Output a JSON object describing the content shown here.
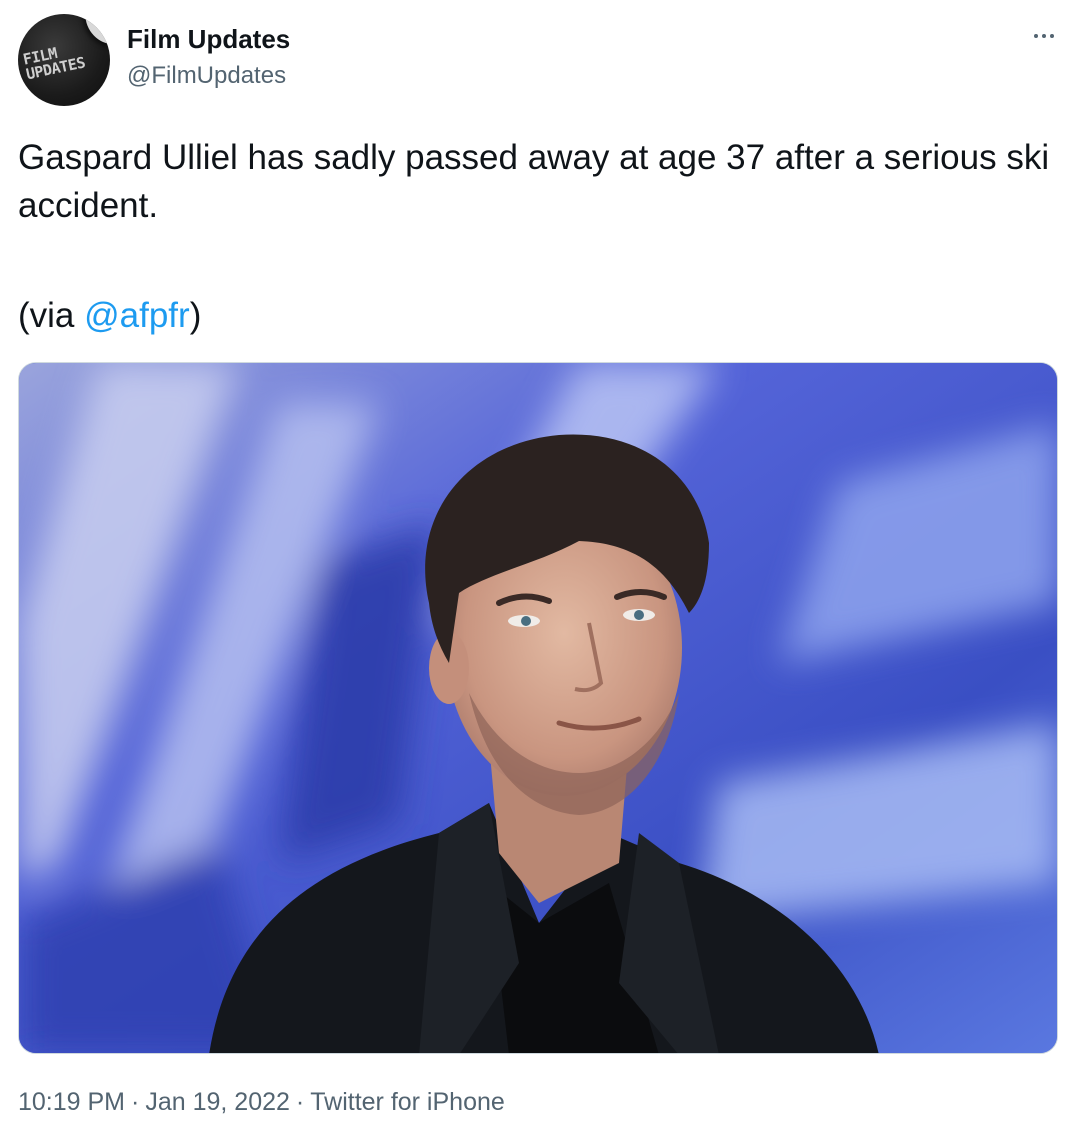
{
  "author": {
    "name": "Film Updates",
    "handle": "@FilmUpdates",
    "avatar_logo_text": "FILM UPDATES"
  },
  "tweet": {
    "text": "Gaspard Ulliel has sadly passed away at age 37 after a serious ski accident.",
    "via_prefix": "(via ",
    "via_mention": "@afpfr",
    "via_suffix": ")"
  },
  "footer": {
    "time": "10:19 PM",
    "separator": "·",
    "date": "Jan 19, 2022",
    "source": "Twitter for iPhone"
  },
  "colors": {
    "link": "#1d9bf0",
    "secondary_text": "#536471",
    "primary_text": "#0f1419",
    "media_background": "#3f56c8"
  },
  "icons": {
    "more": "more-horizontal-icon"
  }
}
